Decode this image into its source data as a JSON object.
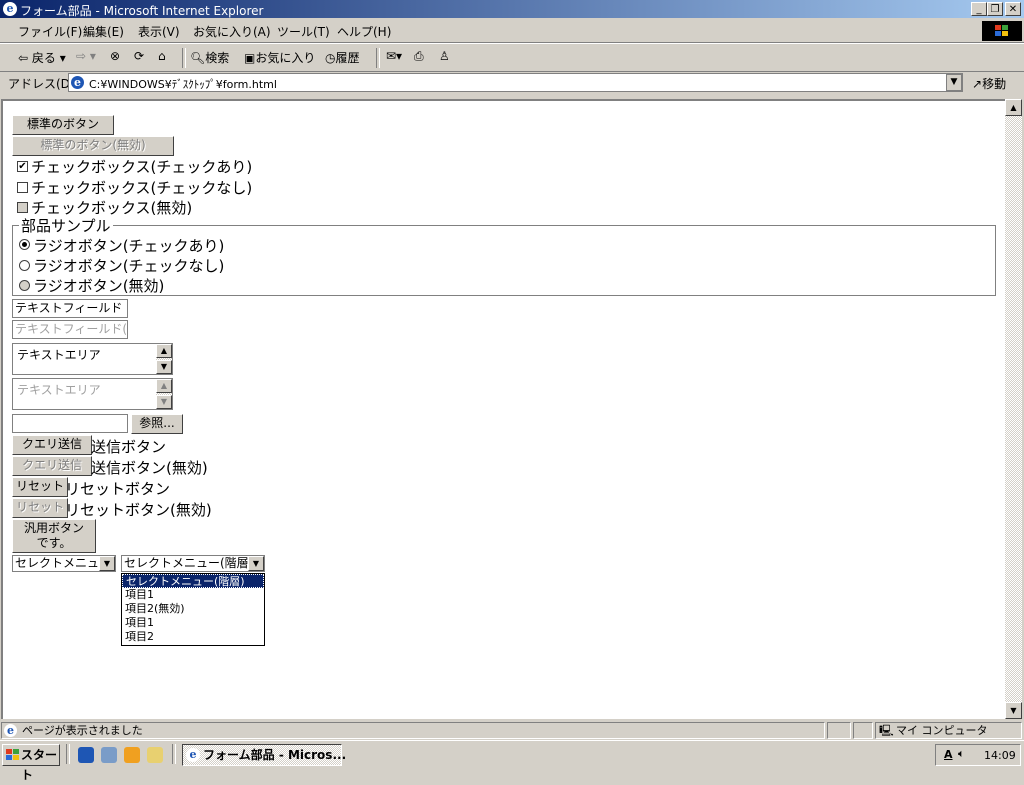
{
  "window": {
    "title": "フォーム部品 - Microsoft Internet Explorer",
    "minimize": "_",
    "maximize": "❐",
    "close": "✕"
  },
  "menu": [
    "ファイル(F)",
    "編集(E)",
    "表示(V)",
    "お気に入り(A)",
    "ツール(T)",
    "ヘルプ(H)"
  ],
  "toolbar": {
    "back": "戻る",
    "search": "検索",
    "favorites": "お気に入り",
    "history": "履歴"
  },
  "address": {
    "label": "アドレス(D)",
    "value": "C:¥WINDOWS¥ﾃﾞｽｸﾄｯﾌﾟ¥form.html",
    "go": "移動"
  },
  "form": {
    "btn_standard": "標準のボタン",
    "btn_standard_disabled": "標準のボタン(無効)",
    "cb_checked": "チェックボックス(チェックあり)",
    "cb_unchecked": "チェックボックス(チェックなし)",
    "cb_disabled": "チェックボックス(無効)",
    "fieldset_legend": "部品サンプル",
    "rb_checked": "ラジオボタン(チェックあり)",
    "rb_unchecked": "ラジオボタン(チェックなし)",
    "rb_disabled": "ラジオボタン(無効)",
    "textfield_value": "テキストフィールド",
    "textfield_disabled_value": "テキストフィールド(無効)",
    "textarea_value": "テキストエリア",
    "textarea_disabled_value": "テキストエリア",
    "browse_button": "参照...",
    "submit_button": "クエリ送信",
    "submit_label": "送信ボタン",
    "submit_disabled_label": "送信ボタン(無効)",
    "reset_button": "リセット",
    "reset_label": "リセットボタン",
    "reset_disabled_label": "リセットボタン(無効)",
    "generic_button_line1": "汎用ボタン",
    "generic_button_line2": "です。",
    "select1_value": "セレクトメニュー",
    "select2_value": "セレクトメニュー(階層)",
    "select2_options": [
      "セレクトメニュー(階層)",
      "項目1",
      "項目2(無効)",
      "項目1",
      "項目2"
    ]
  },
  "status": {
    "text": "ページが表示されました",
    "zone": "マイ コンピュータ"
  },
  "taskbar": {
    "start": "スタート",
    "task": "フォーム部品 - Micros...",
    "clock": "14:09"
  },
  "colors": {
    "title_start": "#0a246a",
    "title_end": "#a6caf0",
    "face": "#d4d0c8",
    "selection": "#0a246a"
  }
}
